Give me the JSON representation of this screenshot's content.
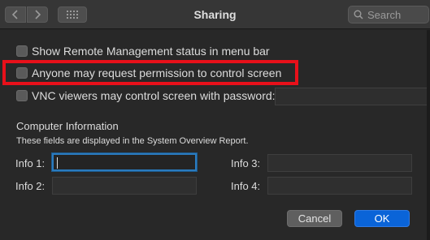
{
  "window": {
    "title": "Sharing",
    "search": {
      "placeholder": "Search"
    }
  },
  "options": [
    {
      "label": "Show Remote Management status in menu bar",
      "checked": false
    },
    {
      "label": "Anyone may request permission to control screen",
      "checked": false,
      "highlighted": true
    },
    {
      "label": "VNC viewers may control screen with password:",
      "checked": false
    }
  ],
  "vnc_password": {
    "value": ""
  },
  "computer_info": {
    "title": "Computer Information",
    "subtitle": "These fields are displayed in the System Overview Report.",
    "fields": [
      {
        "label": "Info 1:",
        "value": "",
        "focused": true
      },
      {
        "label": "Info 2:",
        "value": ""
      },
      {
        "label": "Info 3:",
        "value": ""
      },
      {
        "label": "Info 4:",
        "value": ""
      }
    ]
  },
  "buttons": {
    "cancel": "Cancel",
    "ok": "OK"
  },
  "colors": {
    "highlight": "#e8101a",
    "accent": "#0a64d8",
    "focus": "#2a7bbf"
  }
}
